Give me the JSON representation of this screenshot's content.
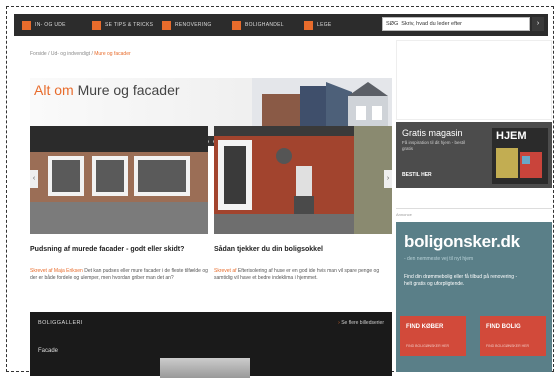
{
  "nav": {
    "items": [
      {
        "label": "IN- OG UDE"
      },
      {
        "label": "SE TIPS & TRICKS"
      },
      {
        "label": "RENOVERING"
      },
      {
        "label": "BOLIGHANDEL"
      },
      {
        "label": "LEGE"
      }
    ],
    "search_value": "SØG  Skriv, hvad du leder efter"
  },
  "breadcrumb": {
    "home": "Forside",
    "sep": "/",
    "parent": "Ud- og indvendigt",
    "current": "Mure og facader"
  },
  "banner": {
    "prefix": "Alt om",
    "title": "Mure og facader"
  },
  "articles": [
    {
      "title": "Pudsning af murede facader - godt eller skidt?",
      "author": "Skrevet af Maja Eriksen",
      "meta": "Det kan pudses eller mure facader i de fleste tilfælde og der er både fordele og ulemper, men hvordan griber man det an?"
    },
    {
      "title": "Sådan tjekker du din boligsokkel",
      "author": "Skrevet af",
      "meta": "Efterisolering af huse er en god ide hvis man vil spare penge og samtidig vil have et bedre indeklima i hjemmet."
    }
  ],
  "gallery": {
    "heading": "BOLIGGALLERI",
    "link": "Se flere billedserier",
    "subheading": "Facade"
  },
  "magazine": {
    "title": "Gratis magasin",
    "sub": "Få inspiration til dit hjem - bestil gratis",
    "button": "BESTIL HER",
    "cover": "HJEM"
  },
  "ad_label": "Annonce",
  "boligonsker": {
    "logo": "boligonsker.dk",
    "tagline": "- den nemmeste vej til nyt hjem",
    "text": "Find din drømmebolig eller få tilbud på renovering - helt gratis og uforpligtende.",
    "btn_left": "FIND KØBER",
    "btn_right": "FIND BOLIG",
    "btn_sub": "FIND BOLIGØNSKER HER"
  },
  "colors": {
    "accent": "#e86c2c",
    "dark": "#2c2c2c",
    "teal": "#5a7f88",
    "red": "#d24a3a"
  }
}
